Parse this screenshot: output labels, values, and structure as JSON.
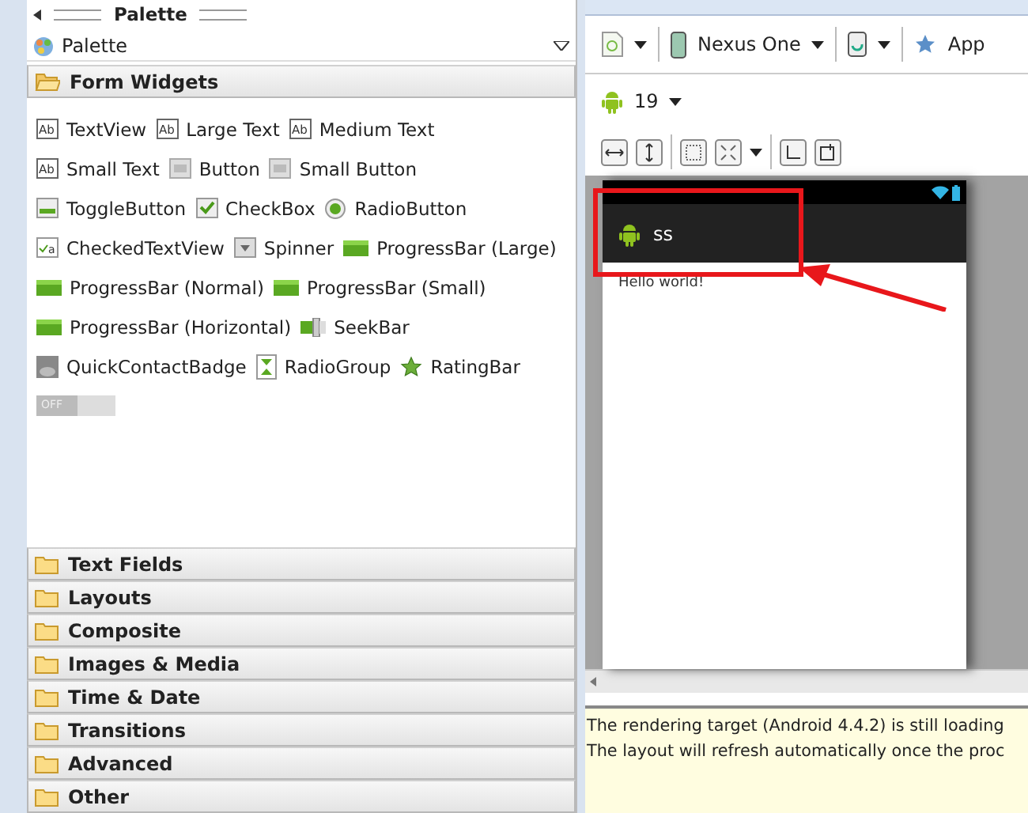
{
  "palette": {
    "title": "Palette",
    "dropdown": "Palette",
    "categories": [
      {
        "label": "Form Widgets",
        "expanded": true,
        "rows": [
          [
            {
              "kind": "text",
              "icon_text": "Ab",
              "label": "TextView"
            },
            {
              "kind": "text",
              "icon_text": "Ab",
              "label": "Large Text"
            },
            {
              "kind": "text",
              "icon_text": "Ab",
              "label": "Medium Text"
            }
          ],
          [
            {
              "kind": "text",
              "icon_text": "Ab",
              "label": "Small Text"
            },
            {
              "kind": "button",
              "label": "Button"
            },
            {
              "kind": "button",
              "label": "Small Button"
            }
          ],
          [
            {
              "kind": "toggle",
              "label": "ToggleButton"
            },
            {
              "kind": "checkbox",
              "label": "CheckBox"
            },
            {
              "kind": "radio",
              "label": "RadioButton"
            }
          ],
          [
            {
              "kind": "checkedtext",
              "icon_text": "a",
              "label": "CheckedTextView"
            },
            {
              "kind": "spinner",
              "label": "Spinner"
            },
            {
              "kind": "progress",
              "label": "ProgressBar (Large)"
            }
          ],
          [
            {
              "kind": "progress",
              "label": "ProgressBar (Normal)"
            },
            {
              "kind": "progress",
              "label": "ProgressBar (Small)"
            }
          ],
          [
            {
              "kind": "progress",
              "label": "ProgressBar (Horizontal)"
            },
            {
              "kind": "seekbar",
              "label": "SeekBar"
            }
          ],
          [
            {
              "kind": "badge",
              "label": "QuickContactBadge"
            },
            {
              "kind": "radiogroup",
              "label": "RadioGroup"
            },
            {
              "kind": "rating",
              "label": "RatingBar"
            }
          ],
          [
            {
              "kind": "switch",
              "label": "OFF"
            }
          ]
        ]
      },
      {
        "label": "Text Fields",
        "expanded": false
      },
      {
        "label": "Layouts",
        "expanded": false
      },
      {
        "label": "Composite",
        "expanded": false
      },
      {
        "label": "Images & Media",
        "expanded": false
      },
      {
        "label": "Time & Date",
        "expanded": false
      },
      {
        "label": "Transitions",
        "expanded": false
      },
      {
        "label": "Advanced",
        "expanded": false
      },
      {
        "label": "Other",
        "expanded": false
      }
    ]
  },
  "editor": {
    "device": "Nexus One",
    "theme": "App",
    "api_level": "19",
    "app_title": "ss",
    "content_text": "Hello world!",
    "messages": [
      "The rendering target (Android 4.4.2) is still loading",
      "The layout will refresh automatically once the proc"
    ]
  }
}
